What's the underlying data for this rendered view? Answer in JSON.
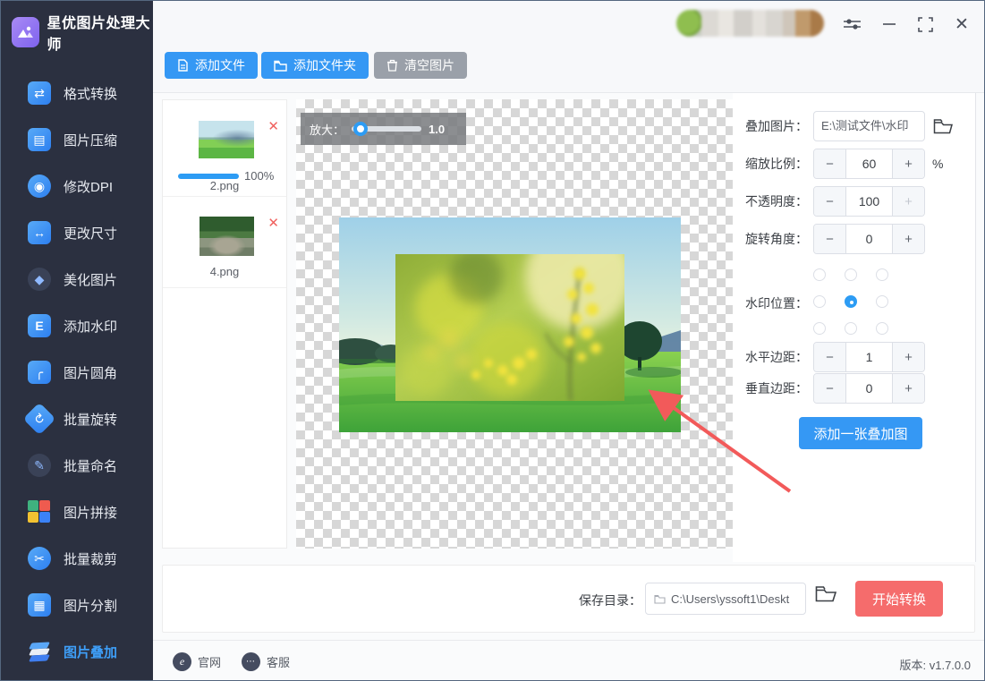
{
  "app": {
    "title": "星优图片处理大师"
  },
  "sidebar": {
    "items": [
      {
        "label": "格式转换",
        "icon": "format-convert-icon"
      },
      {
        "label": "图片压缩",
        "icon": "image-compress-icon"
      },
      {
        "label": "修改DPI",
        "icon": "modify-dpi-icon"
      },
      {
        "label": "更改尺寸",
        "icon": "resize-icon"
      },
      {
        "label": "美化图片",
        "icon": "beautify-icon"
      },
      {
        "label": "添加水印",
        "icon": "watermark-icon"
      },
      {
        "label": "图片圆角",
        "icon": "round-corner-icon"
      },
      {
        "label": "批量旋转",
        "icon": "batch-rotate-icon"
      },
      {
        "label": "批量命名",
        "icon": "batch-rename-icon"
      },
      {
        "label": "图片拼接",
        "icon": "image-stitch-icon"
      },
      {
        "label": "批量裁剪",
        "icon": "batch-crop-icon"
      },
      {
        "label": "图片分割",
        "icon": "image-split-icon"
      },
      {
        "label": "图片叠加",
        "icon": "image-overlay-icon"
      }
    ],
    "active_label": "图片叠加"
  },
  "toolbar": {
    "add_file": "添加文件",
    "add_folder": "添加文件夹",
    "clear_images": "清空图片"
  },
  "file_list": [
    {
      "name": "2.png",
      "progress": "100%"
    },
    {
      "name": "4.png",
      "progress": ""
    }
  ],
  "preview": {
    "zoom_label": "放大：",
    "zoom_value": "1.0"
  },
  "settings": {
    "overlay_image": {
      "label": "叠加图片：",
      "value": "E:\\测试文件\\水印"
    },
    "scale": {
      "label": "缩放比例：",
      "value": "60",
      "unit": "%"
    },
    "opacity": {
      "label": "不透明度：",
      "value": "100"
    },
    "rotation": {
      "label": "旋转角度：",
      "value": "0"
    },
    "position": {
      "label": "水印位置：",
      "selected_index": 4
    },
    "h_margin": {
      "label": "水平边距：",
      "value": "1"
    },
    "v_margin": {
      "label": "垂直边距：",
      "value": "0"
    },
    "add_overlay_button": "添加一张叠加图",
    "minus_sign": "−",
    "plus_sign": "+"
  },
  "save": {
    "label": "保存目录：",
    "path": "C:\\Users\\yssoft1\\Deskt",
    "start_button": "开始转换"
  },
  "footer": {
    "website": "官网",
    "support": "客服",
    "version": "版本: v1.7.0.0"
  },
  "colors": {
    "accent_blue": "#3598f4",
    "danger_red": "#f56c6c",
    "sidebar_bg": "#2b3040",
    "active_text": "#3e9ef7",
    "progress_blue": "#2d9cf4"
  }
}
